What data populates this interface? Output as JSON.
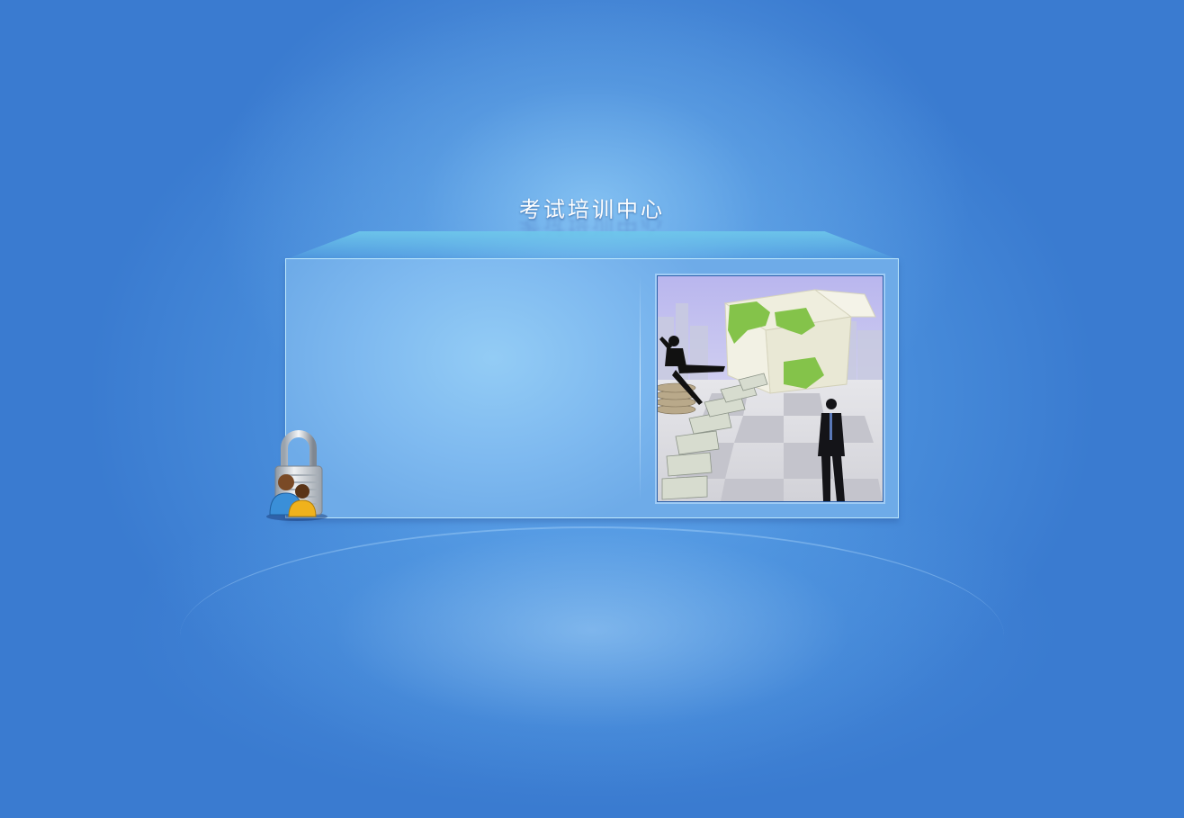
{
  "page": {
    "title": "考试培训中心"
  },
  "icons": {
    "lock": "lock-with-users-icon"
  },
  "illustration": {
    "subject": "business-globe-illustration"
  },
  "colors": {
    "background": "#3a7bd0",
    "panel": "#7fbaf0",
    "title": "#ffffff"
  }
}
